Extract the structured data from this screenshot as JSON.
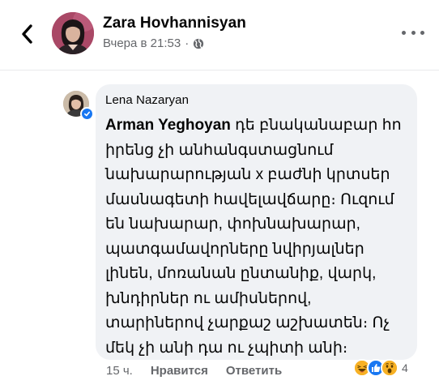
{
  "header": {
    "author_name": "Zara Hovhannisyan",
    "timestamp": "Вчера в 21:53",
    "separator": "·",
    "privacy_icon": "globe-icon",
    "back_icon": "chevron-left-icon",
    "more_icon": "more-dots-icon"
  },
  "comment": {
    "author": "Lena Nazaryan",
    "mention": "Arman Yeghoyan",
    "text": " դե բնականաբար հո իրենց չի անհանգստացնում նախարարության x բաժնի կրտսեր մասնագետի հավելավճարը։ Ուզում են նախարար, փոխնախարար, պատգամավորները նվիրյալներ լինեն, մոռանան ընտանիք, վարկ, խնդիրներ ու ամիսներով, տարիներով չարքաշ աշխատեն։ Ոչ մեկ չի անի դա ու չպիտի անի։",
    "verified_icon": "verified-check-icon",
    "time_ago": "15 ч.",
    "like_label": "Нравится",
    "reply_label": "Ответить",
    "reaction_count": "4",
    "reactions": [
      "haha-icon",
      "like-icon",
      "wow-icon"
    ]
  },
  "colors": {
    "bubble": "#f0f2f5",
    "secondary_text": "#65676b",
    "like_blue": "#1877f2",
    "emoji_yellow": "#f7b125"
  }
}
